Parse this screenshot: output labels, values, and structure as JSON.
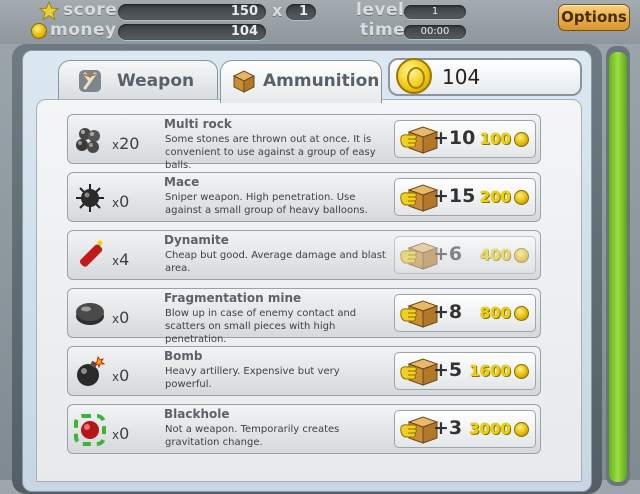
{
  "hud": {
    "score_label": "score",
    "score_value": "150",
    "multiplier_label": "x",
    "multiplier_value": "1",
    "money_label": "money",
    "money_value": "104",
    "level_label": "level",
    "level_value": "1",
    "time_label": "time",
    "time_value": "00:00",
    "options_label": "Options"
  },
  "tabs": [
    {
      "label": "Weapon",
      "icon": "slingshot-icon",
      "active": false
    },
    {
      "label": "Ammunition",
      "icon": "crate-icon",
      "active": true
    }
  ],
  "coins": {
    "value": "104",
    "icon": "coin-icon"
  },
  "items": [
    {
      "name": "Multi rock",
      "count_prefix": "x",
      "count": "20",
      "description": "Some stones are thrown out at once. It is convenient to use against a group of easy balls.",
      "buy_qty": "+10",
      "price": "100",
      "icon": "rocks-icon",
      "enabled": true
    },
    {
      "name": "Mace",
      "count_prefix": "x",
      "count": "0",
      "description": "Sniper weapon. High penetration. Use against a small group of heavy balloons.",
      "buy_qty": "+15",
      "price": "200",
      "icon": "spiked-mace-icon",
      "enabled": true
    },
    {
      "name": "Dynamite",
      "count_prefix": "x",
      "count": "4",
      "description": "Cheap but good. Average damage and blast area.",
      "buy_qty": "+6",
      "price": "400",
      "icon": "dynamite-icon",
      "enabled": false
    },
    {
      "name": "Fragmentation mine",
      "count_prefix": "x",
      "count": "0",
      "description": "Blow up in case of enemy contact and scatters on small pieces with high penetration.",
      "buy_qty": "+8",
      "price": "800",
      "icon": "mine-icon",
      "enabled": true
    },
    {
      "name": "Bomb",
      "count_prefix": "x",
      "count": "0",
      "description": "Heavy artillery. Expensive but very powerful.",
      "buy_qty": "+5",
      "price": "1600",
      "icon": "bomb-icon",
      "enabled": true
    },
    {
      "name": "Blackhole",
      "count_prefix": "x",
      "count": "0",
      "description": "Not a weapon. Temporarily creates gravitation change.",
      "buy_qty": "+3",
      "price": "3000",
      "icon": "blackhole-icon",
      "enabled": true
    }
  ],
  "colors": {
    "accent_green": "#7cc52a",
    "price_yellow": "#f0d000",
    "options_orange": "#e3a33a"
  }
}
